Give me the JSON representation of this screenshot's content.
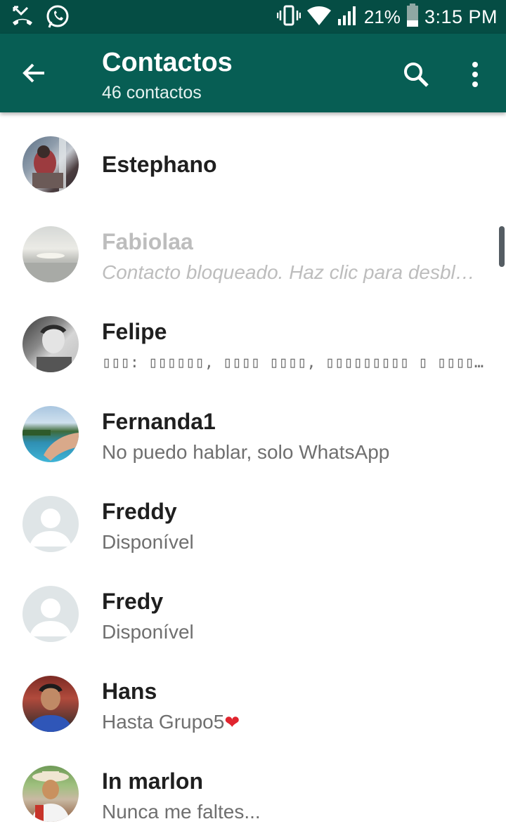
{
  "status_bar": {
    "battery_percent": "21%",
    "time": "3:15 PM",
    "icons": [
      "missed-call-icon",
      "whatsapp-icon",
      "vibrate-icon",
      "wifi-icon",
      "signal-icon",
      "battery-icon"
    ]
  },
  "app_bar": {
    "title": "Contactos",
    "subtitle": "46 contactos",
    "color": "#075e54",
    "status_color": "#054d44"
  },
  "contacts": [
    {
      "name": "Estephano",
      "status": "",
      "avatar": "photo"
    },
    {
      "name": "Fabiolaa",
      "status": "Contacto bloqueado. Haz clic para desbl…",
      "avatar": "photo",
      "blocked": true
    },
    {
      "name": "Felipe",
      "status": "▯▯▯: ▯▯▯▯▯▯, ▯▯▯▯ ▯▯▯▯, ▯▯▯▯▯▯▯▯▯ ▯ ▯▯▯▯▯ ▯▯▯…",
      "avatar": "photo"
    },
    {
      "name": "Fernanda1",
      "status": "No puedo hablar, solo WhatsApp",
      "avatar": "photo"
    },
    {
      "name": "Freddy",
      "status": "Disponível",
      "avatar": "default"
    },
    {
      "name": "Fredy",
      "status": "Disponível",
      "avatar": "default"
    },
    {
      "name": "Hans",
      "status": "Hasta Grupo5",
      "status_emoji": "❤",
      "avatar": "photo"
    },
    {
      "name": "In marlon",
      "status": "Nunca me faltes...",
      "avatar": "photo"
    }
  ]
}
